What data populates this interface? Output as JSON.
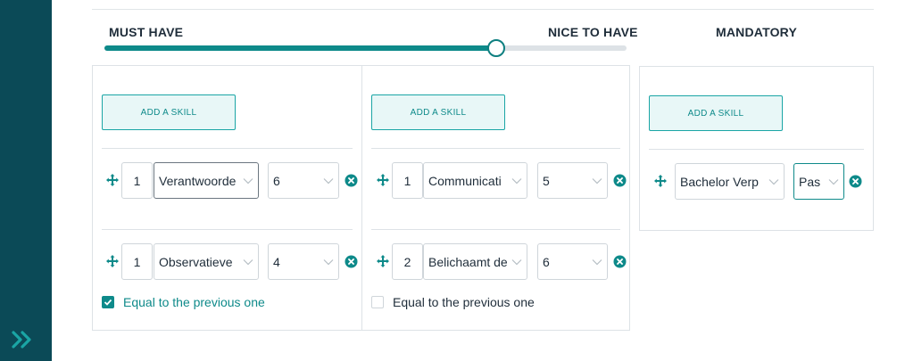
{
  "slider": {
    "left_label": "MUST HAVE",
    "right_label": "NICE TO HAVE",
    "position_percent": 75
  },
  "mandatory_label": "MANDATORY",
  "add_skill_label": "ADD A SKILL",
  "equal_label": "Equal to the previous one",
  "columns": [
    {
      "rows": [
        {
          "order": "1",
          "skill": "Verantwoorde",
          "level": "6"
        },
        {
          "order": "1",
          "skill": "Observatieve",
          "level": "4"
        }
      ],
      "equal_checked": true
    },
    {
      "rows": [
        {
          "order": "1",
          "skill": "Communicati",
          "level": "5"
        },
        {
          "order": "2",
          "skill": "Belichaamt de",
          "level": "6"
        }
      ],
      "equal_checked": false
    }
  ],
  "mandatory": {
    "skill": "Bachelor Verp",
    "level": "Pas"
  },
  "colors": {
    "sidebar": "#0b4a57",
    "accent": "#0e8a8a",
    "button_bg": "#e8f7f7"
  }
}
